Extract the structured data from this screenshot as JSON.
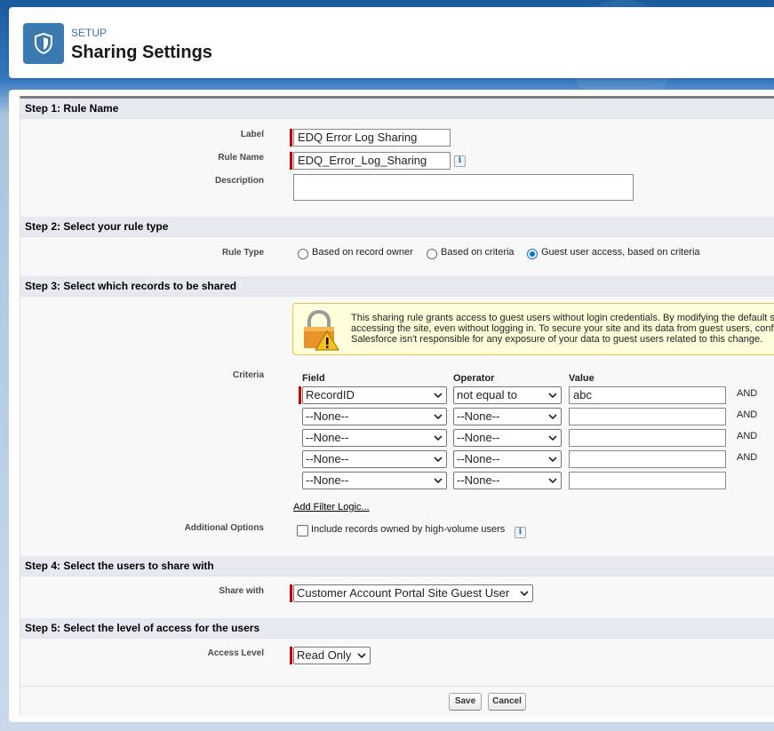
{
  "header": {
    "eyebrow": "SETUP",
    "title": "Sharing Settings",
    "icon": "shield-icon"
  },
  "step1": {
    "heading": "Step 1: Rule Name",
    "label_label": "Label",
    "label_value": "EDQ Error Log Sharing",
    "rule_name_label": "Rule Name",
    "rule_name_value": "EDQ_Error_Log_Sharing",
    "description_label": "Description",
    "description_value": ""
  },
  "step2": {
    "heading": "Step 2: Select your rule type",
    "rule_type_label": "Rule Type",
    "options": [
      "Based on record owner",
      "Based on criteria",
      "Guest user access, based on criteria"
    ],
    "selected_index": 2
  },
  "step3": {
    "heading": "Step 3: Select which records to be shared",
    "warning_lines": [
      "This sharing rule grants access to guest users without login credentials. By modifying the default sharing settings, you grant",
      "accessing the site, even without logging in. To secure your site and its data from guest users, configure the appropriate",
      "Salesforce isn't responsible for any exposure of your data to guest users related to this change."
    ],
    "criteria_label": "Criteria",
    "col_field": "Field",
    "col_operator": "Operator",
    "col_value": "Value",
    "rows": [
      {
        "field": "RecordID",
        "operator": "not equal to",
        "value": "abc",
        "conj": "AND"
      },
      {
        "field": "--None--",
        "operator": "--None--",
        "value": "",
        "conj": "AND"
      },
      {
        "field": "--None--",
        "operator": "--None--",
        "value": "",
        "conj": "AND"
      },
      {
        "field": "--None--",
        "operator": "--None--",
        "value": "",
        "conj": "AND"
      },
      {
        "field": "--None--",
        "operator": "--None--",
        "value": "",
        "conj": ""
      }
    ],
    "add_filter_logic": "Add Filter Logic...",
    "additional_options_label": "Additional Options",
    "include_high_volume_label": "Include records owned by high-volume users",
    "include_high_volume_checked": false
  },
  "step4": {
    "heading": "Step 4: Select the users to share with",
    "share_with_label": "Share with",
    "share_with_value": "Customer Account Portal Site Guest User"
  },
  "step5": {
    "heading": "Step 5: Select the level of access for the users",
    "access_level_label": "Access Level",
    "access_level_value": "Read Only"
  },
  "buttons": {
    "save": "Save",
    "cancel": "Cancel"
  },
  "colors": {
    "required": "#cc0000",
    "brand": "#3b79b1",
    "warning_bg": "#ffffdc"
  }
}
